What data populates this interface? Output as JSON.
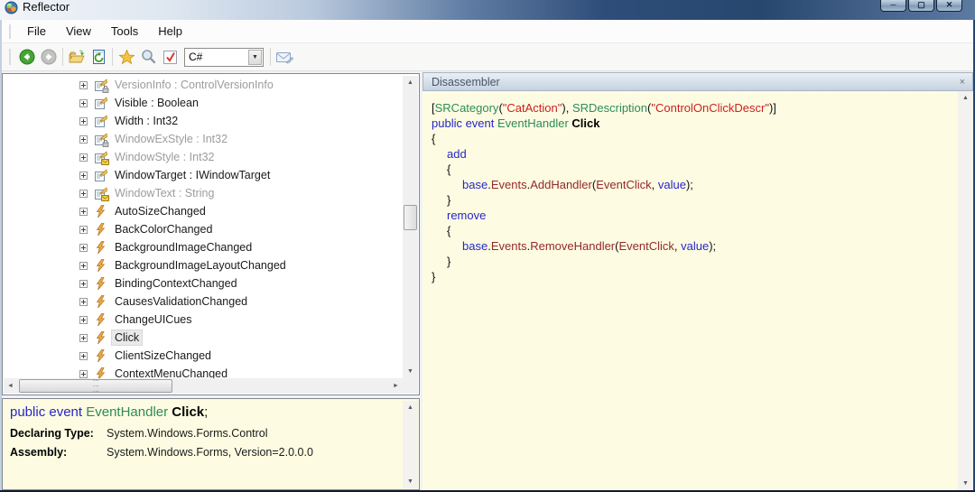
{
  "window": {
    "title": "Reflector"
  },
  "menu": {
    "items": [
      "File",
      "View",
      "Tools",
      "Help"
    ]
  },
  "toolbar": {
    "language_selector": {
      "value": "C#"
    },
    "buttons": [
      "back",
      "forward",
      "open",
      "refresh",
      "favorites",
      "search",
      "options-check",
      "send"
    ]
  },
  "tree": {
    "items": [
      {
        "label": "VersionInfo : ControlVersionInfo",
        "kind": "property",
        "muted": true,
        "overlay": "lock",
        "selected": false
      },
      {
        "label": "Visible : Boolean",
        "kind": "property",
        "muted": false,
        "overlay": null,
        "selected": false
      },
      {
        "label": "Width : Int32",
        "kind": "property",
        "muted": false,
        "overlay": null,
        "selected": false
      },
      {
        "label": "WindowExStyle : Int32",
        "kind": "property",
        "muted": true,
        "overlay": "lock",
        "selected": false
      },
      {
        "label": "WindowStyle : Int32",
        "kind": "property",
        "muted": true,
        "overlay": "protected",
        "selected": false
      },
      {
        "label": "WindowTarget : IWindowTarget",
        "kind": "property",
        "muted": false,
        "overlay": null,
        "selected": false
      },
      {
        "label": "WindowText : String",
        "kind": "property",
        "muted": true,
        "overlay": "protected",
        "selected": false
      },
      {
        "label": "AutoSizeChanged",
        "kind": "event",
        "muted": false,
        "overlay": null,
        "selected": false
      },
      {
        "label": "BackColorChanged",
        "kind": "event",
        "muted": false,
        "overlay": null,
        "selected": false
      },
      {
        "label": "BackgroundImageChanged",
        "kind": "event",
        "muted": false,
        "overlay": null,
        "selected": false
      },
      {
        "label": "BackgroundImageLayoutChanged",
        "kind": "event",
        "muted": false,
        "overlay": null,
        "selected": false
      },
      {
        "label": "BindingContextChanged",
        "kind": "event",
        "muted": false,
        "overlay": null,
        "selected": false
      },
      {
        "label": "CausesValidationChanged",
        "kind": "event",
        "muted": false,
        "overlay": null,
        "selected": false
      },
      {
        "label": "ChangeUICues",
        "kind": "event",
        "muted": false,
        "overlay": null,
        "selected": false
      },
      {
        "label": "Click",
        "kind": "event",
        "muted": false,
        "overlay": null,
        "selected": true
      },
      {
        "label": "ClientSizeChanged",
        "kind": "event",
        "muted": false,
        "overlay": null,
        "selected": false
      },
      {
        "label": "ContextMenuChanged",
        "kind": "event",
        "muted": false,
        "overlay": null,
        "selected": false
      }
    ]
  },
  "disassembler": {
    "title": "Disassembler",
    "close_label": "×",
    "code_lines": [
      {
        "indent": 0,
        "tokens": [
          [
            "[",
            "pl"
          ],
          [
            "SRCategory",
            "ty"
          ],
          [
            "(",
            "pl"
          ],
          [
            "\"CatAction\"",
            "st"
          ],
          [
            "), ",
            "pl"
          ],
          [
            "SRDescription",
            "ty"
          ],
          [
            "(",
            "pl"
          ],
          [
            "\"ControlOnClickDescr\"",
            "st"
          ],
          [
            ")]",
            "pl"
          ]
        ]
      },
      {
        "indent": 0,
        "tokens": [
          [
            "public event ",
            "kw"
          ],
          [
            "EventHandler",
            "ty"
          ],
          [
            " ",
            "pl"
          ],
          [
            "Click",
            "decl"
          ]
        ]
      },
      {
        "indent": 0,
        "tokens": [
          [
            "{",
            "pl"
          ]
        ]
      },
      {
        "indent": 1,
        "tokens": [
          [
            "add",
            "kw"
          ]
        ]
      },
      {
        "indent": 1,
        "tokens": [
          [
            "{",
            "pl"
          ]
        ]
      },
      {
        "indent": 2,
        "tokens": [
          [
            "base",
            "kw"
          ],
          [
            ".",
            "pl"
          ],
          [
            "Events",
            "mem"
          ],
          [
            ".",
            "pl"
          ],
          [
            "AddHandler",
            "mem"
          ],
          [
            "(",
            "pl"
          ],
          [
            "EventClick",
            "mem"
          ],
          [
            ", ",
            "pl"
          ],
          [
            "value",
            "kw"
          ],
          [
            ");",
            "pl"
          ]
        ]
      },
      {
        "indent": 1,
        "tokens": [
          [
            "}",
            "pl"
          ]
        ]
      },
      {
        "indent": 1,
        "tokens": [
          [
            "remove",
            "kw"
          ]
        ]
      },
      {
        "indent": 1,
        "tokens": [
          [
            "{",
            "pl"
          ]
        ]
      },
      {
        "indent": 2,
        "tokens": [
          [
            "base",
            "kw"
          ],
          [
            ".",
            "pl"
          ],
          [
            "Events",
            "mem"
          ],
          [
            ".",
            "pl"
          ],
          [
            "RemoveHandler",
            "mem"
          ],
          [
            "(",
            "pl"
          ],
          [
            "EventClick",
            "mem"
          ],
          [
            ", ",
            "pl"
          ],
          [
            "value",
            "kw"
          ],
          [
            ");",
            "pl"
          ]
        ]
      },
      {
        "indent": 1,
        "tokens": [
          [
            "}",
            "pl"
          ]
        ]
      },
      {
        "indent": 0,
        "tokens": [
          [
            "}",
            "pl"
          ]
        ]
      }
    ]
  },
  "details": {
    "signature_tokens": [
      [
        "public event ",
        "kw"
      ],
      [
        "EventHandler",
        "ty"
      ],
      [
        " ",
        "pl"
      ],
      [
        "Click",
        "decl"
      ],
      [
        ";",
        "pl"
      ]
    ],
    "fields": [
      {
        "label": "Declaring Type:",
        "value": "System.Windows.Forms.Control"
      },
      {
        "label": "Assembly:",
        "value": "System.Windows.Forms, Version=2.0.0.0"
      }
    ]
  }
}
